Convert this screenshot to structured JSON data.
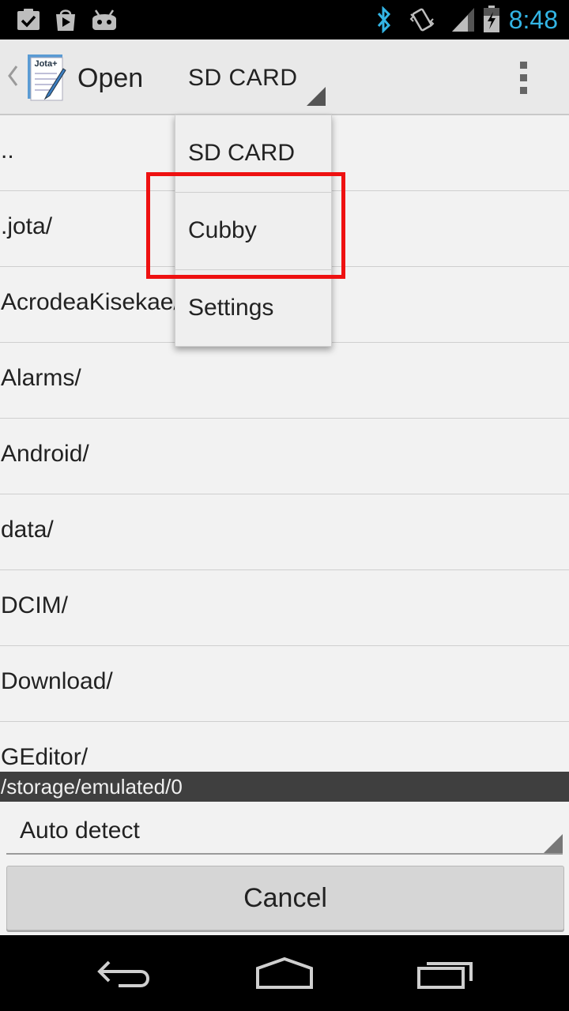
{
  "status_bar": {
    "time": "8:48",
    "left_icons": [
      "clipboard-check-icon",
      "play-store-icon",
      "android-icon"
    ],
    "right_icons": [
      "bluetooth-icon",
      "vibrate-icon",
      "signal-icon",
      "battery-charging-icon"
    ],
    "time_color": "#33b5e5"
  },
  "action_bar": {
    "title": "Open",
    "app_icon_text": "Jota+",
    "spinner_label": "SD CARD"
  },
  "dropdown": {
    "items": [
      {
        "label": "SD CARD"
      },
      {
        "label": "Cubby"
      },
      {
        "label": "Settings"
      }
    ]
  },
  "files": [
    {
      "name": ".."
    },
    {
      "name": ".jota/"
    },
    {
      "name": "AcrodeaKisekae/"
    },
    {
      "name": "Alarms/"
    },
    {
      "name": "Android/"
    },
    {
      "name": "data/"
    },
    {
      "name": "DCIM/"
    },
    {
      "name": "Download/"
    },
    {
      "name": "GEditor/"
    }
  ],
  "path": "/storage/emulated/0",
  "encoding": {
    "selected": "Auto detect"
  },
  "buttons": {
    "cancel": "Cancel"
  },
  "nav_bar": {
    "icons": [
      "back-icon",
      "home-icon",
      "recents-icon"
    ]
  },
  "colors": {
    "highlight": "#ee1111",
    "accent": "#33b5e5"
  }
}
